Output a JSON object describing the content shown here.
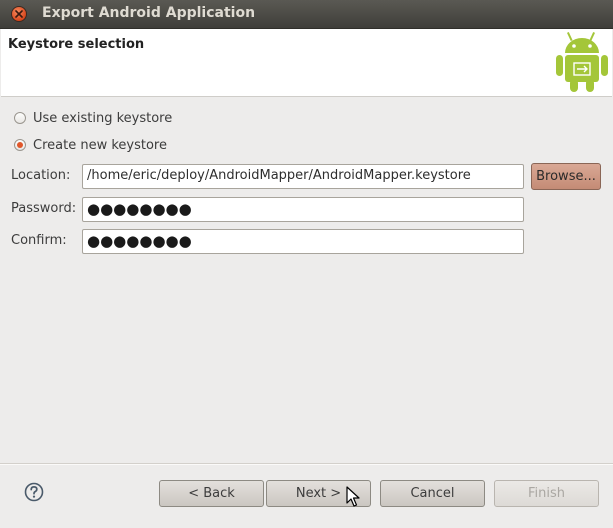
{
  "window": {
    "title": "Export Android Application"
  },
  "banner": {
    "title": "Keystore selection"
  },
  "options": {
    "use_existing": "Use existing keystore",
    "create_new": "Create new keystore",
    "selected": "create_new"
  },
  "fields": {
    "location_label": "Location:",
    "location_value": "/home/eric/deploy/AndroidMapper/AndroidMapper.keystore",
    "password_label": "Password:",
    "password_value": "●●●●●●●●",
    "confirm_label": "Confirm:",
    "confirm_value": "●●●●●●●●"
  },
  "buttons": {
    "browse": "Browse...",
    "back": "< Back",
    "next": "Next >",
    "cancel": "Cancel",
    "finish": "Finish"
  },
  "icons": {
    "close": "close-icon",
    "logo": "android-logo-icon",
    "help": "help-icon",
    "cursor": "mouse-cursor-icon"
  },
  "colors": {
    "accent": "#e0572a",
    "android_green": "#a4c639"
  }
}
